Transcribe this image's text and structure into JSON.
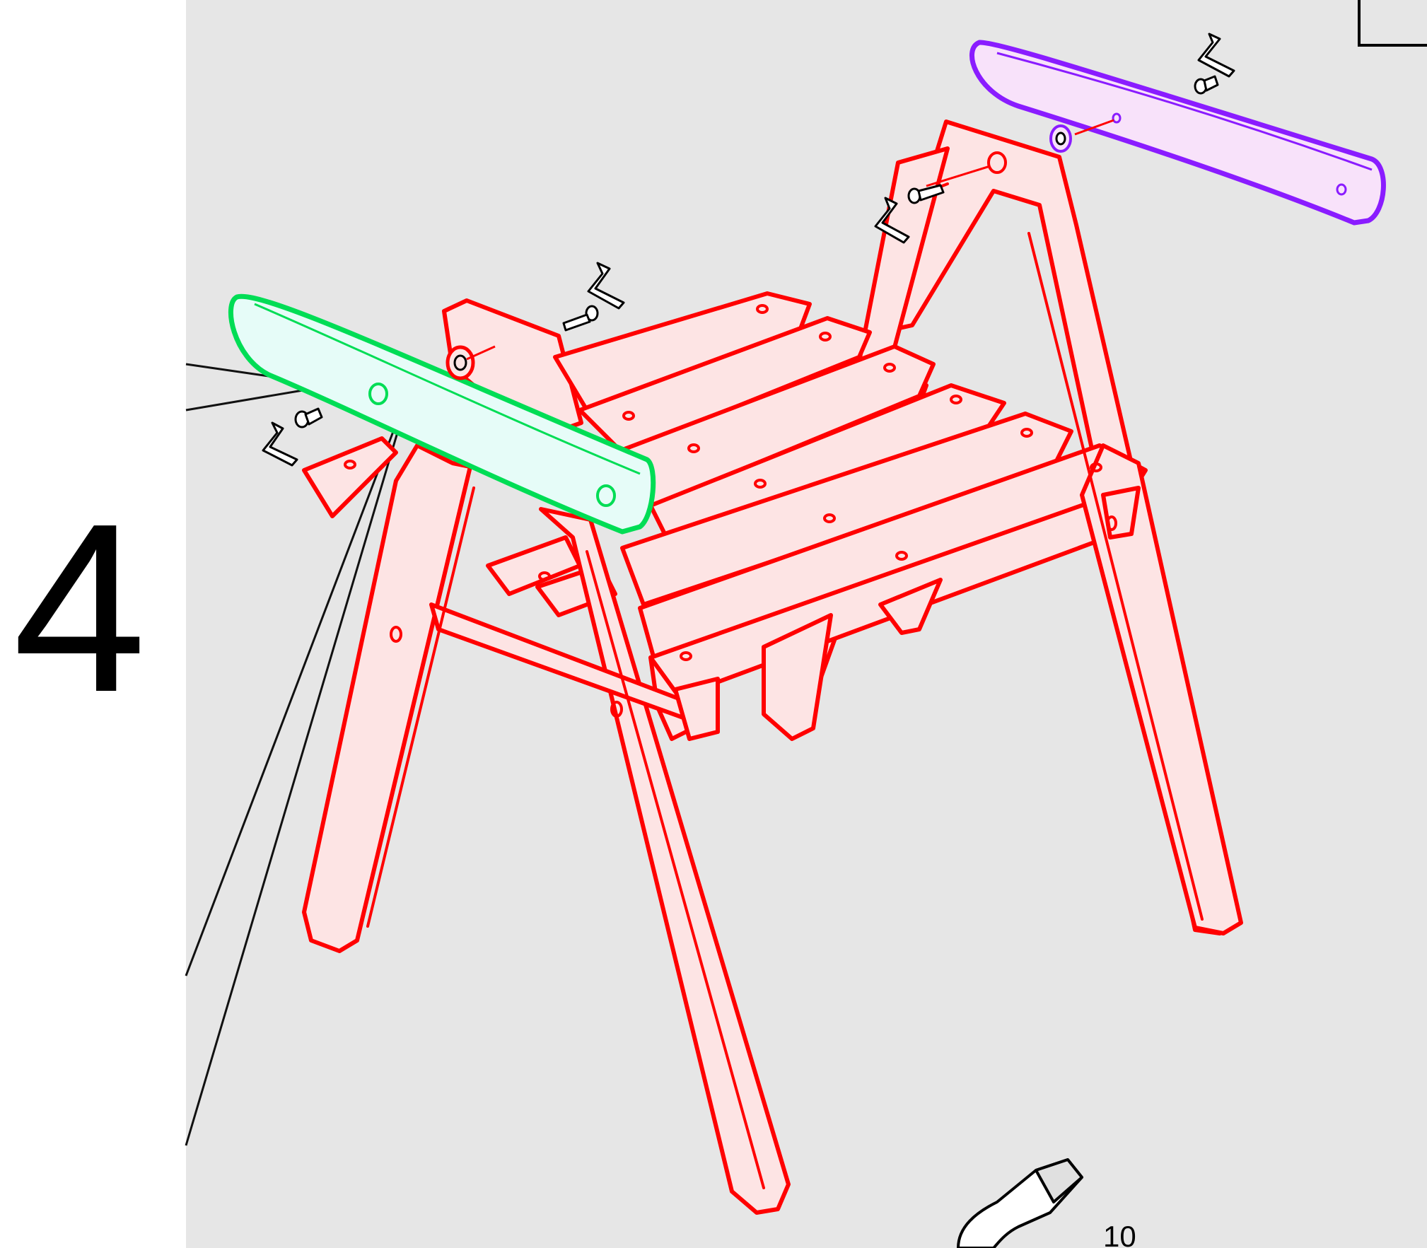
{
  "step": {
    "number": "4",
    "page_label": "10"
  },
  "colors": {
    "panel_background": "#e6e6e6",
    "frame_outline": "#ff0000",
    "frame_fill": "#fde4e4",
    "left_armrest_outline": "#00dd55",
    "left_armrest_fill": "#e6fcf8",
    "right_armrest_outline": "#8a1cff",
    "right_armrest_fill": "#f8e2fa",
    "line_art": "#000000"
  },
  "icons": {
    "allen_key": "allen-key-icon",
    "bolt": "bolt-icon",
    "barrel_nut": "barrel-nut-icon",
    "wrench_tool": "hex-tool-icon"
  }
}
